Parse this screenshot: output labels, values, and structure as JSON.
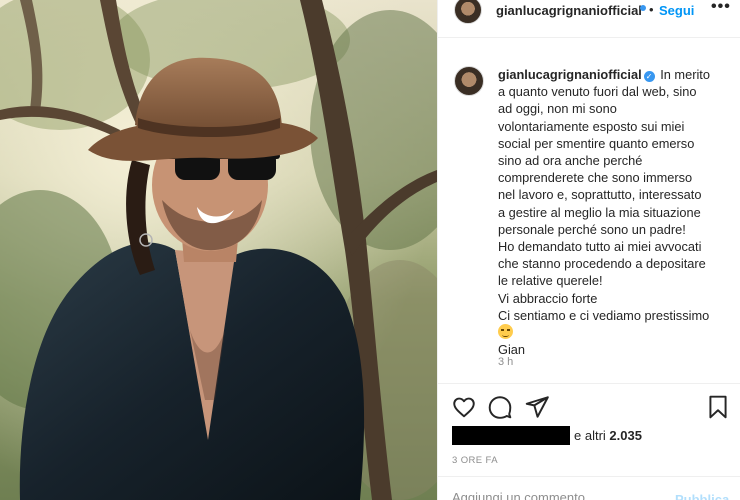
{
  "post": {
    "username": "gianlucagrignaniofficial",
    "follow_label": "Segui",
    "separator": "•",
    "more_label": "•••",
    "caption_lines": [
      "a quanto venuto fuori dal web, sino",
      "ad oggi, non mi sono",
      "volontariamente esposto sui miei",
      "social per smentire quanto emerso",
      "sino ad ora anche perché",
      "comprenderete che sono immerso",
      "nel lavoro e, soprattutto, interessato",
      "a gestire al meglio la mia situazione",
      "personale perché sono un padre!",
      "Ho demandato tutto ai miei avvocati",
      "che stanno procedendo a depositare",
      "le relative querele!",
      "Vi abbraccio forte",
      "Ci sentiamo e ci vediamo prestissimo"
    ],
    "caption_first": "In merito",
    "caption_sign": "Gian",
    "caption_time": "3 h",
    "likes_text": "e altri ",
    "likes_count": "2.035",
    "post_time": "3 ORE FA",
    "comment_placeholder": "Aggiungi un commento...",
    "publish_label": "Pubblica",
    "verified_badge": "✓"
  },
  "icons": {
    "like": "heart-icon",
    "comment": "comment-icon",
    "share": "share-icon",
    "save": "bookmark-icon",
    "caption_emoji": "wink-emoji-icon"
  },
  "colors": {
    "accent": "#0095f6",
    "verified": "#3897f0",
    "muted": "#8e8e8e",
    "publish_disabled": "#b2dffc"
  }
}
